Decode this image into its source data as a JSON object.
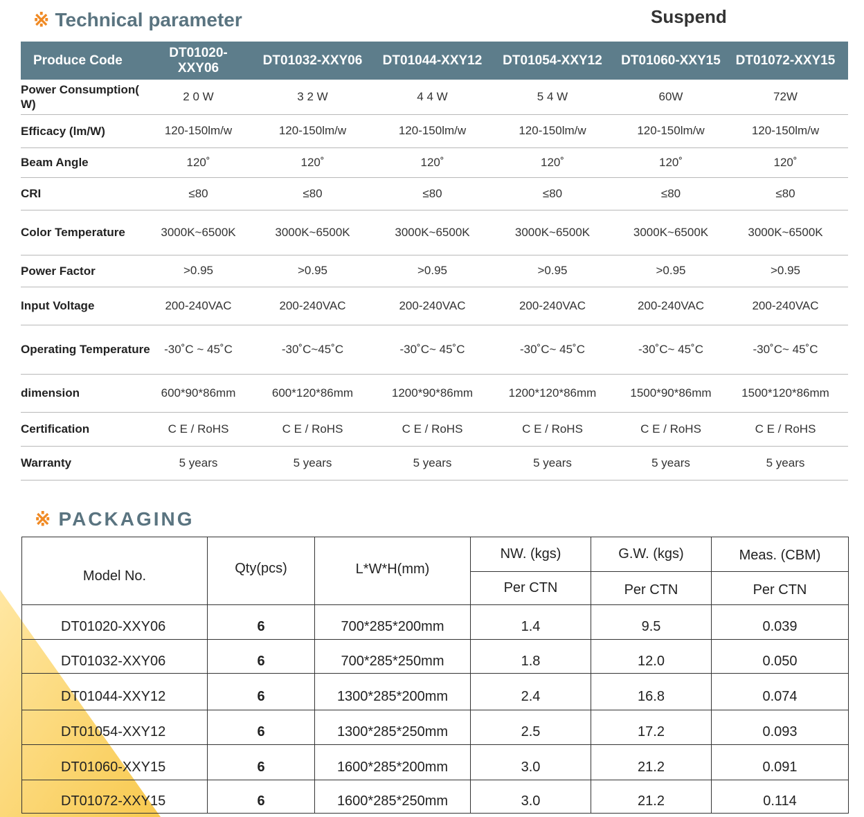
{
  "tech": {
    "mark": "※",
    "title": "Technical parameter",
    "mode": "Suspend",
    "headers": [
      "Produce Code",
      "DT01020-XXY06",
      "DT01032-XXY06",
      "DT01044-XXY12",
      "DT01054-XXY12",
      "DT01060-XXY15",
      "DT01072-XXY15"
    ],
    "rows": [
      {
        "label": "Power Consumption( W)",
        "values": [
          "2 0 W",
          "3 2 W",
          "4 4 W",
          "5 4 W",
          "60W",
          "72W"
        ]
      },
      {
        "label": "Efficacy (lm/W)",
        "values": [
          "120-150lm/w",
          "120-150lm/w",
          "120-150lm/w",
          "120-150lm/w",
          "120-150lm/w",
          "120-150lm/w"
        ]
      },
      {
        "label": "Beam   Angle",
        "values": [
          "120˚",
          "120˚",
          "120˚",
          "120˚",
          "120˚",
          "120˚"
        ]
      },
      {
        "label": "CRI",
        "values": [
          "≤80",
          "≤80",
          "≤80",
          "≤80",
          "≤80",
          "≤80"
        ]
      },
      {
        "label": "Color Temperature",
        "values": [
          "3000K~6500K",
          "3000K~6500K",
          "3000K~6500K",
          "3000K~6500K",
          "3000K~6500K",
          "3000K~6500K"
        ]
      },
      {
        "label": "Power Factor",
        "values": [
          ">0.95",
          ">0.95",
          ">0.95",
          ">0.95",
          ">0.95",
          ">0.95"
        ]
      },
      {
        "label": "Input Voltage",
        "values": [
          "200-240VAC",
          "200-240VAC",
          "200-240VAC",
          "200-240VAC",
          "200-240VAC",
          "200-240VAC"
        ]
      },
      {
        "label": "Operating Temperature",
        "values": [
          "-30˚C ~ 45˚C",
          "-30˚C~45˚C",
          "-30˚C~ 45˚C",
          "-30˚C~ 45˚C",
          "-30˚C~ 45˚C",
          "-30˚C~ 45˚C"
        ]
      },
      {
        "label": "dimension",
        "values": [
          "600*90*86mm",
          "600*120*86mm",
          "1200*90*86mm",
          "1200*120*86mm",
          "1500*90*86mm",
          "1500*120*86mm"
        ]
      },
      {
        "label": "Certification",
        "values": [
          "C E / RoHS",
          "C E / RoHS",
          "C E / RoHS",
          "C E / RoHS",
          "C E / RoHS",
          "C E / RoHS"
        ]
      },
      {
        "label": "Warranty",
        "values": [
          "5 years",
          "5 years",
          "5 years",
          "5 years",
          "5 years",
          "5 years"
        ]
      }
    ]
  },
  "packaging": {
    "mark": "※",
    "title": "PACKAGING",
    "headers": {
      "model": "Model No.",
      "qty": "Qty(pcs)",
      "lwh": "L*W*H(mm)",
      "nw": "NW. (kgs)",
      "gw": "G.W. (kgs)",
      "meas": "Meas. (CBM)",
      "per_ctn": "Per CTN"
    },
    "rows": [
      {
        "model": "DT01020-XXY06",
        "qty": "6",
        "lwh": "700*285*200mm",
        "nw": "1.4",
        "gw": "9.5",
        "meas": "0.039"
      },
      {
        "model": "DT01032-XXY06",
        "qty": "6",
        "lwh": "700*285*250mm",
        "nw": "1.8",
        "gw": "12.0",
        "meas": "0.050"
      },
      {
        "model": "DT01044-XXY12",
        "qty": "6",
        "lwh": "1300*285*200mm",
        "nw": "2.4",
        "gw": "16.8",
        "meas": "0.074"
      },
      {
        "model": "DT01054-XXY12",
        "qty": "6",
        "lwh": "1300*285*250mm",
        "nw": "2.5",
        "gw": "17.2",
        "meas": "0.093"
      },
      {
        "model": "DT01060-XXY15",
        "qty": "6",
        "lwh": "1600*285*200mm",
        "nw": "3.0",
        "gw": "21.2",
        "meas": "0.091"
      },
      {
        "model": "DT01072-XXY15",
        "qty": "6",
        "lwh": "1600*285*250mm",
        "nw": "3.0",
        "gw": "21.2",
        "meas": "0.114"
      }
    ]
  },
  "colors": {
    "header_bg": "#5d7d8b",
    "title_text": "#5a7480",
    "mark": "#f08a24",
    "accent_yellow": "#fbd46a"
  }
}
